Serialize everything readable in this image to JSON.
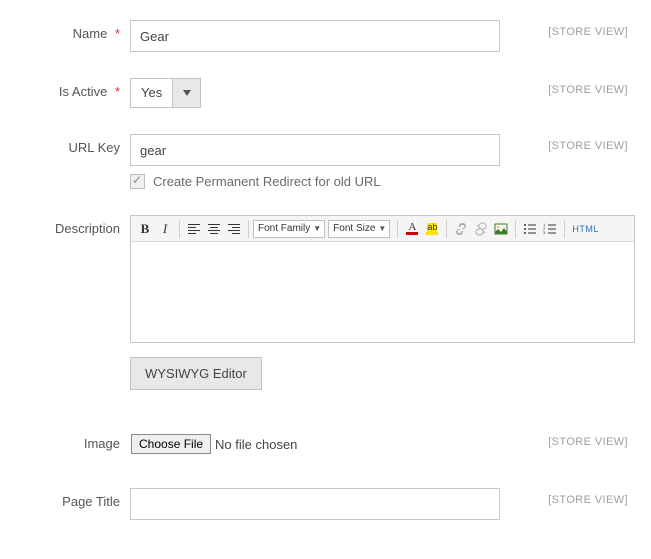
{
  "fields": {
    "name": {
      "label": "Name",
      "value": "Gear",
      "scope": "[STORE VIEW]"
    },
    "is_active": {
      "label": "Is Active",
      "value": "Yes",
      "scope": "[STORE VIEW]"
    },
    "url_key": {
      "label": "URL Key",
      "value": "gear",
      "scope": "[STORE VIEW]",
      "redirect_label": "Create Permanent Redirect for old URL"
    },
    "description": {
      "label": "Description"
    },
    "image": {
      "label": "Image",
      "button": "Choose File",
      "status": "No file chosen",
      "scope": "[STORE VIEW]"
    },
    "page_title": {
      "label": "Page Title",
      "value": "",
      "scope": "[STORE VIEW]"
    }
  },
  "rte": {
    "font_family_label": "Font Family",
    "font_size_label": "Font Size",
    "html_label": "HTML",
    "text_color_letter": "A",
    "highlight_label": "ab"
  },
  "buttons": {
    "wysiwyg": "WYSIWYG Editor"
  }
}
